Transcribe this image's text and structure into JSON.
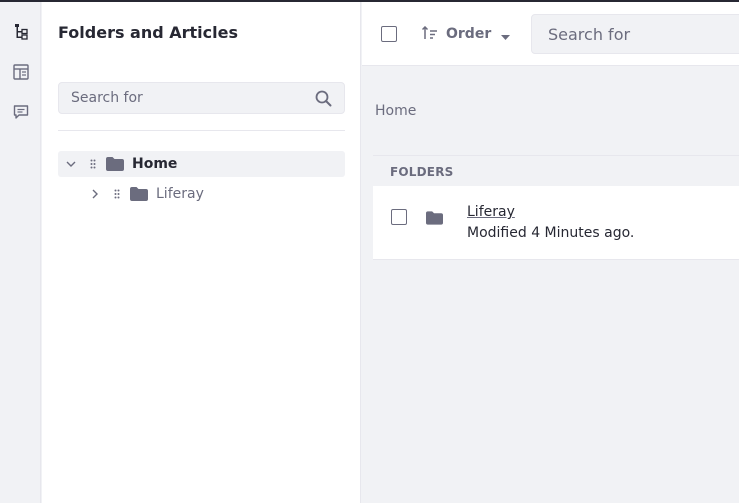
{
  "icons": {
    "rail": [
      "tree-structure-icon",
      "web-content-icon",
      "comments-icon"
    ],
    "search": "search-icon",
    "folder": "folder-icon",
    "order": "sort-icon",
    "caret": "caret-down-icon",
    "expand": "chevron-down-icon",
    "collapse": "chevron-right-icon",
    "drag": "drag-handle-icon"
  },
  "colors": {
    "text_primary": "#272833",
    "text_secondary": "#6b6c7e",
    "panel_bg": "#ffffff",
    "page_bg": "#f1f2f5",
    "border": "#e7e7ed"
  },
  "sidebar": {
    "title": "Folders and Articles",
    "search_placeholder": "Search for",
    "tree": [
      {
        "label": "Home",
        "expanded": true,
        "selected": true
      },
      {
        "label": "Liferay",
        "expanded": false,
        "selected": false
      }
    ]
  },
  "toolbar": {
    "order_label": "Order",
    "search_placeholder": "Search for"
  },
  "breadcrumb": "Home",
  "folders_section": {
    "heading": "FOLDERS",
    "items": [
      {
        "title": "Liferay",
        "subtitle": "Modified 4 Minutes ago."
      }
    ]
  }
}
